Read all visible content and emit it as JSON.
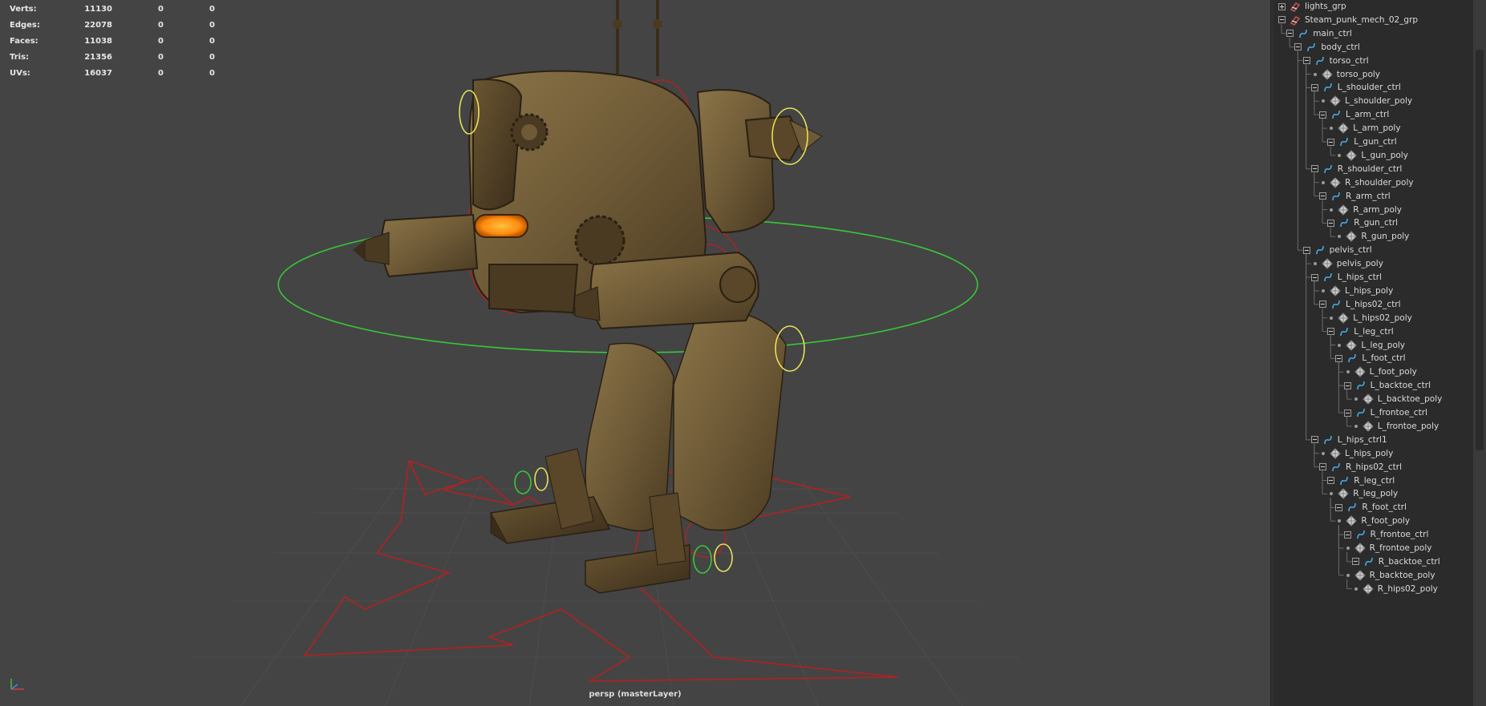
{
  "stats": [
    {
      "label": "Verts:",
      "v1": "11130",
      "v2": "0",
      "v3": "0"
    },
    {
      "label": "Edges:",
      "v1": "22078",
      "v2": "0",
      "v3": "0"
    },
    {
      "label": "Faces:",
      "v1": "11038",
      "v2": "0",
      "v3": "0"
    },
    {
      "label": "Tris:",
      "v1": "21356",
      "v2": "0",
      "v3": "0"
    },
    {
      "label": "UVs:",
      "v1": "16037",
      "v2": "0",
      "v3": "0"
    }
  ],
  "viewport": {
    "camera_label": "persp (masterLayer)"
  },
  "colors": {
    "viewport_bg": "#444444",
    "outliner_bg": "#2b2b2b",
    "selection_red": "#b42020",
    "ctrl_yellow": "#e6e05a",
    "ctrl_green": "#38c838",
    "ctrl_icon_blue": "#4aa8e0",
    "group_icon_red": "#c05050"
  },
  "outliner": {
    "items": [
      {
        "label": "lights_grp",
        "type": "group",
        "state": "collapsed"
      },
      {
        "label": "Steam_punk_mech_02_grp",
        "type": "group",
        "state": "expanded"
      },
      {
        "label": "main_ctrl",
        "type": "curve",
        "state": "expanded"
      },
      {
        "label": "body_ctrl",
        "type": "curve",
        "state": "expanded"
      },
      {
        "label": "torso_ctrl",
        "type": "curve",
        "state": "expanded"
      },
      {
        "label": "torso_poly",
        "type": "mesh",
        "state": "leaf"
      },
      {
        "label": "L_shoulder_ctrl",
        "type": "curve",
        "state": "expanded"
      },
      {
        "label": "L_shoulder_poly",
        "type": "mesh",
        "state": "leaf"
      },
      {
        "label": "L_arm_ctrl",
        "type": "curve",
        "state": "expanded"
      },
      {
        "label": "L_arm_poly",
        "type": "mesh",
        "state": "leaf"
      },
      {
        "label": "L_gun_ctrl",
        "type": "curve",
        "state": "expanded"
      },
      {
        "label": "L_gun_poly",
        "type": "mesh",
        "state": "leaf"
      },
      {
        "label": "R_shoulder_ctrl",
        "type": "curve",
        "state": "expanded"
      },
      {
        "label": "R_shoulder_poly",
        "type": "mesh",
        "state": "leaf"
      },
      {
        "label": "R_arm_ctrl",
        "type": "curve",
        "state": "expanded"
      },
      {
        "label": "R_arm_poly",
        "type": "mesh",
        "state": "leaf"
      },
      {
        "label": "R_gun_ctrl",
        "type": "curve",
        "state": "expanded"
      },
      {
        "label": "R_gun_poly",
        "type": "mesh",
        "state": "leaf"
      },
      {
        "label": "pelvis_ctrl",
        "type": "curve",
        "state": "expanded"
      },
      {
        "label": "pelvis_poly",
        "type": "mesh",
        "state": "leaf"
      },
      {
        "label": "L_hips_ctrl",
        "type": "curve",
        "state": "expanded"
      },
      {
        "label": "L_hips_poly",
        "type": "mesh",
        "state": "leaf"
      },
      {
        "label": "L_hips02_ctrl",
        "type": "curve",
        "state": "expanded"
      },
      {
        "label": "L_hips02_poly",
        "type": "mesh",
        "state": "leaf"
      },
      {
        "label": "L_leg_ctrl",
        "type": "curve",
        "state": "expanded"
      },
      {
        "label": "L_leg_poly",
        "type": "mesh",
        "state": "leaf"
      },
      {
        "label": "L_foot_ctrl",
        "type": "curve",
        "state": "expanded"
      },
      {
        "label": "L_foot_poly",
        "type": "mesh",
        "state": "leaf"
      },
      {
        "label": "L_backtoe_ctrl",
        "type": "curve",
        "state": "expanded"
      },
      {
        "label": "L_backtoe_poly",
        "type": "mesh",
        "state": "leaf"
      },
      {
        "label": "L_frontoe_ctrl",
        "type": "curve",
        "state": "expanded"
      },
      {
        "label": "L_frontoe_poly",
        "type": "mesh",
        "state": "leaf"
      },
      {
        "label": "L_hips_ctrl1",
        "type": "curve",
        "state": "expanded"
      },
      {
        "label": "L_hips_poly",
        "type": "mesh",
        "state": "leaf"
      },
      {
        "label": "R_hips02_ctrl",
        "type": "curve",
        "state": "expanded"
      },
      {
        "label": "R_leg_ctrl",
        "type": "curve",
        "state": "expanded"
      },
      {
        "label": "R_leg_poly",
        "type": "mesh",
        "state": "leaf"
      },
      {
        "label": "R_foot_ctrl",
        "type": "curve",
        "state": "expanded"
      },
      {
        "label": "R_foot_poly",
        "type": "mesh",
        "state": "leaf"
      },
      {
        "label": "R_frontoe_ctrl",
        "type": "curve",
        "state": "expanded"
      },
      {
        "label": "R_frontoe_poly",
        "type": "mesh",
        "state": "leaf"
      },
      {
        "label": "R_backtoe_ctrl",
        "type": "curve",
        "state": "expanded"
      },
      {
        "label": "R_backtoe_poly",
        "type": "mesh",
        "state": "leaf"
      },
      {
        "label": "R_hips02_poly",
        "type": "mesh",
        "state": "leaf"
      }
    ]
  }
}
